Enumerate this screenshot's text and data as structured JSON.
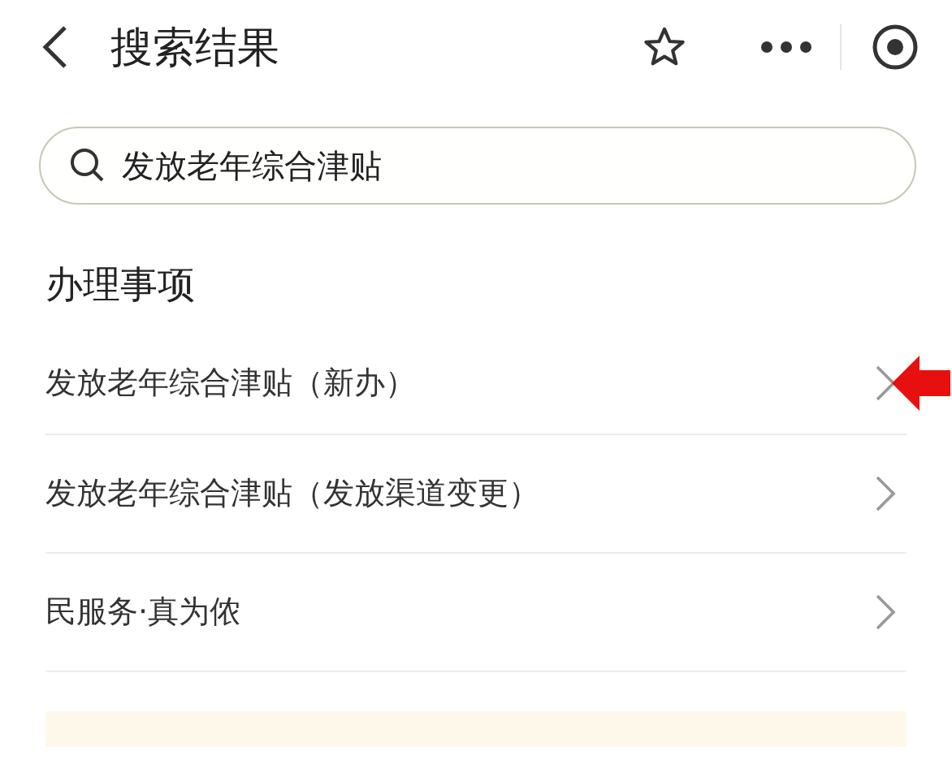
{
  "header": {
    "title": "搜索结果"
  },
  "search": {
    "value": "发放老年综合津贴"
  },
  "section": {
    "title": "办理事项"
  },
  "items": [
    {
      "label": "发放老年综合津贴（新办）",
      "highlighted": true
    },
    {
      "label": "发放老年综合津贴（发放渠道变更）",
      "highlighted": false
    },
    {
      "label": "民服务·真为侬",
      "highlighted": false
    }
  ]
}
